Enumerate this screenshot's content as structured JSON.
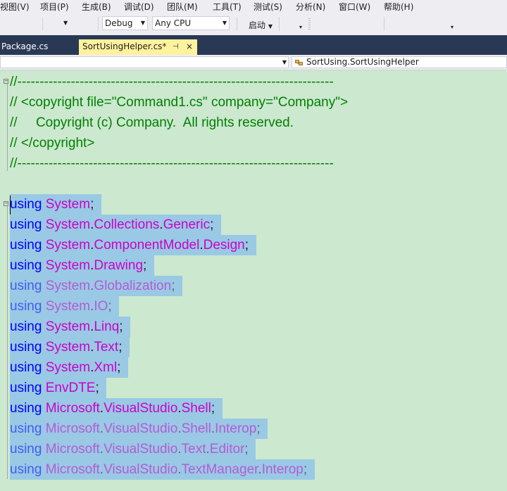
{
  "menu": [
    "视图(V)",
    "项目(P)",
    "生成(B)",
    "调试(D)",
    "团队(M)",
    "工具(T)",
    "测试(S)",
    "分析(N)",
    "窗口(W)",
    "帮助(H)"
  ],
  "toolbar": {
    "configuration": "Debug",
    "platform": "Any CPU",
    "launch_label": "启动"
  },
  "tabs": {
    "inactive": "Package.cs",
    "active": "SortUsingHelper.cs*",
    "pin_glyph": "⊣",
    "close_glyph": "×"
  },
  "navbar": {
    "type_label": "SortUsing.SortUsingHelper"
  },
  "code": {
    "header": [
      "//-----------------------------------------------------------------------",
      "// <copyright file=\"Command1.cs\" company=\"Company\">",
      "//     Copyright (c) Company.  All rights reserved.",
      "// </copyright>",
      "//-----------------------------------------------------------------------"
    ],
    "using_keyword": "using",
    "usings": [
      {
        "parts": [
          "System"
        ],
        "faded": false
      },
      {
        "parts": [
          "System",
          "Collections",
          "Generic"
        ],
        "faded": false
      },
      {
        "parts": [
          "System",
          "ComponentModel",
          "Design"
        ],
        "faded": false
      },
      {
        "parts": [
          "System",
          "Drawing"
        ],
        "faded": false
      },
      {
        "parts": [
          "System",
          "Globalization"
        ],
        "faded": true
      },
      {
        "parts": [
          "System",
          "IO"
        ],
        "faded": true
      },
      {
        "parts": [
          "System",
          "Linq"
        ],
        "faded": false
      },
      {
        "parts": [
          "System",
          "Text"
        ],
        "faded": false
      },
      {
        "parts": [
          "System",
          "Xml"
        ],
        "faded": false
      },
      {
        "parts": [
          "EnvDTE"
        ],
        "faded": false
      },
      {
        "parts": [
          "Microsoft",
          "VisualStudio",
          "Shell"
        ],
        "faded": false
      },
      {
        "parts": [
          "Microsoft",
          "VisualStudio",
          "Shell",
          "Interop"
        ],
        "faded": true
      },
      {
        "parts": [
          "Microsoft",
          "VisualStudio",
          "Text",
          "Editor"
        ],
        "faded": true
      },
      {
        "parts": [
          "Microsoft",
          "VisualStudio",
          "TextManager",
          "Interop"
        ],
        "faded": true
      }
    ]
  },
  "colors": {
    "editor_bg": "#cce8cf",
    "selection": "#99c9e4",
    "keyword": "#0000ff",
    "namespace": "#cc00cc",
    "comment": "#008000",
    "active_tab": "#fff29d",
    "tab_strip": "#293955"
  }
}
